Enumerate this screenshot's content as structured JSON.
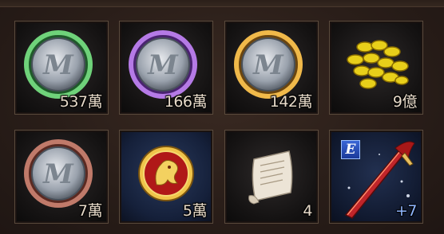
{
  "inventory": {
    "slots": [
      {
        "icon": "green-medal-coin-icon",
        "ring_color": "#5fbf6a",
        "quantity": "537萬"
      },
      {
        "icon": "purple-medal-coin-icon",
        "ring_color": "#a56cd8",
        "quantity": "166萬"
      },
      {
        "icon": "gold-medal-coin-icon",
        "ring_color": "#e0a840",
        "quantity": "142萬"
      },
      {
        "icon": "gold-coins-pile-icon",
        "ring_color": "#e8d020",
        "quantity": "9億"
      },
      {
        "icon": "red-medal-coin-icon",
        "ring_color": "#b06858",
        "quantity": "7萬"
      },
      {
        "icon": "lion-emblem-coin-icon",
        "ring_color": "#d8a830",
        "quantity": "5萬"
      },
      {
        "icon": "scroll-document-icon",
        "ring_color": "#d8d0c0",
        "quantity": "4"
      },
      {
        "icon": "red-sword-icon",
        "ring_color": "#c02828",
        "quantity": "+7",
        "badge": "E"
      }
    ]
  }
}
